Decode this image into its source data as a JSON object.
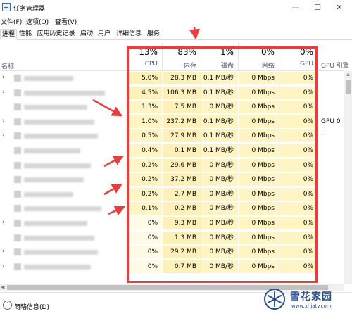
{
  "window": {
    "title": "任务管理器",
    "minimize_glyph": "—",
    "maximize_glyph": "☐",
    "close_glyph": "✕"
  },
  "menu": [
    "文件(F)",
    "选项(O)",
    "查看(V)"
  ],
  "tabs": [
    "进程",
    "性能",
    "应用历史记录",
    "启动",
    "用户",
    "详细信息",
    "服务"
  ],
  "active_tab": "进程",
  "sort_indicator": "˅",
  "columns": {
    "name": "名称",
    "cpu": {
      "label": "CPU",
      "pct": "13%"
    },
    "memory": {
      "label": "内存",
      "pct": "83%"
    },
    "disk": {
      "label": "磁盘",
      "pct": "1%"
    },
    "network": {
      "label": "网络",
      "pct": "0%"
    },
    "gpu": {
      "label": "GPU",
      "pct": "0%"
    },
    "gpu_engine": {
      "label": "GPU 引擎"
    }
  },
  "rows": [
    {
      "expandable": true,
      "cpu": "5.0%",
      "memory": "28.3 MB",
      "disk": "0.1 MB/秒",
      "network": "0 Mbps",
      "gpu": "0%",
      "gpu_engine": ""
    },
    {
      "expandable": true,
      "cpu": "4.5%",
      "memory": "106.3 MB",
      "disk": "0.1 MB/秒",
      "network": "0 Mbps",
      "gpu": "0%",
      "gpu_engine": ""
    },
    {
      "expandable": false,
      "cpu": "1.3%",
      "memory": "7.5 MB",
      "disk": "0 MB/秒",
      "network": "0 Mbps",
      "gpu": "0%",
      "gpu_engine": ""
    },
    {
      "expandable": true,
      "cpu": "1.0%",
      "memory": "237.2 MB",
      "disk": "0.1 MB/秒",
      "network": "0 Mbps",
      "gpu": "0%",
      "gpu_engine": "GPU 0 -"
    },
    {
      "expandable": true,
      "cpu": "0.5%",
      "memory": "27.9 MB",
      "disk": "0.1 MB/秒",
      "network": "0 Mbps",
      "gpu": "0%",
      "gpu_engine": ""
    },
    {
      "expandable": false,
      "cpu": "0.4%",
      "memory": "0.1 MB",
      "disk": "0.1 MB/秒",
      "network": "0 Mbps",
      "gpu": "0%",
      "gpu_engine": ""
    },
    {
      "expandable": false,
      "cpu": "0.2%",
      "memory": "29.6 MB",
      "disk": "0 MB/秒",
      "network": "0 Mbps",
      "gpu": "0%",
      "gpu_engine": ""
    },
    {
      "expandable": false,
      "cpu": "0.2%",
      "memory": "37.2 MB",
      "disk": "0 MB/秒",
      "network": "0 Mbps",
      "gpu": "0%",
      "gpu_engine": ""
    },
    {
      "expandable": false,
      "cpu": "0.2%",
      "memory": "2.7 MB",
      "disk": "0 MB/秒",
      "network": "0 Mbps",
      "gpu": "0%",
      "gpu_engine": ""
    },
    {
      "expandable": false,
      "cpu": "0.1%",
      "memory": "0.2 MB",
      "disk": "0 MB/秒",
      "network": "0 Mbps",
      "gpu": "0%",
      "gpu_engine": ""
    },
    {
      "expandable": true,
      "cpu": "0%",
      "memory": "9.3 MB",
      "disk": "0 MB/秒",
      "network": "0 Mbps",
      "gpu": "0%",
      "gpu_engine": ""
    },
    {
      "expandable": false,
      "cpu": "0%",
      "memory": "1.3 MB",
      "disk": "0 MB/秒",
      "network": "0 Mbps",
      "gpu": "0%",
      "gpu_engine": ""
    },
    {
      "expandable": true,
      "cpu": "0%",
      "memory": "29.2 MB",
      "disk": "0 MB/秒",
      "network": "0 Mbps",
      "gpu": "0%",
      "gpu_engine": ""
    },
    {
      "expandable": true,
      "cpu": "0%",
      "memory": "0.7 MB",
      "disk": "0 MB/秒",
      "network": "0 Mbps",
      "gpu": "0%",
      "gpu_engine": ""
    }
  ],
  "footer": {
    "label": "简略信息(D)",
    "icon": "chevron-up-icon"
  },
  "watermark": {
    "name": "雪花家园",
    "url": "www.xhjaty.com"
  },
  "colors": {
    "cpu_heat": [
      "#fdf0b8",
      "#fdf0b8",
      "#fff4c4",
      "#fff4c4",
      "#fff4c4",
      "#fff4c4",
      "#fff4c4",
      "#fff4c4",
      "#fff4c4",
      "#fff4c4",
      "#fffbe6",
      "#fffbe6",
      "#fffbe6",
      "#fffbe6"
    ],
    "cell_light": "#fff4c4",
    "mem_heat": "#fdf0b8",
    "annotation": "#e53e3e",
    "brand": "#2a4d8f"
  }
}
